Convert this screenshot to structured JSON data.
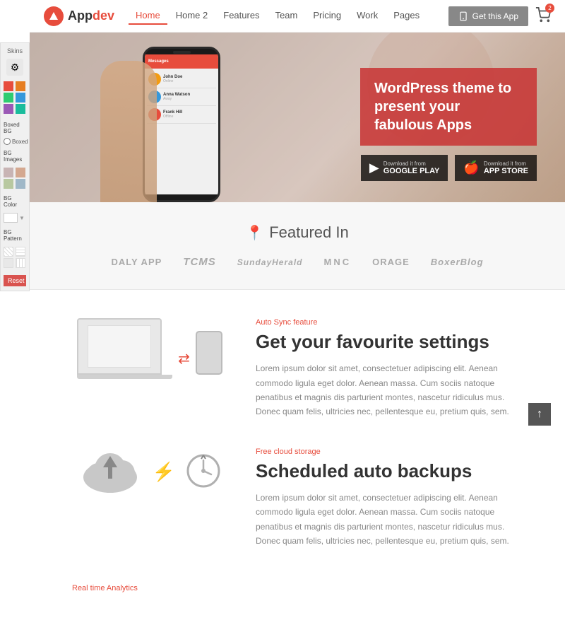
{
  "skins": {
    "label": "Skins",
    "colors": [
      "#e74c3c",
      "#e67e22",
      "#2ecc71",
      "#3498db",
      "#9b59b6",
      "#1abc9c",
      "#e74c3c",
      "#f39c12"
    ],
    "boxed_bg_label": "Boxed BG",
    "boxed_label": "Boxed",
    "bg_images_label": "BG Images",
    "bg_color_label": "BG Color",
    "bg_pattern_label": "BG Pattern",
    "reset_label": "Reset",
    "bg_images": [
      "#c8b4b4",
      "#d4a890",
      "#b8c8a0",
      "#a0b8c8"
    ]
  },
  "navbar": {
    "logo_text": "Appdev",
    "links": [
      "Home",
      "Home 2",
      "Features",
      "Team",
      "Pricing",
      "Work",
      "Pages"
    ],
    "active_link": "Home",
    "get_app_label": "Get this App",
    "cart_count": "2"
  },
  "hero": {
    "title": "WordPress theme to present your fabulous Apps",
    "google_play_small": "Download it from",
    "google_play_large": "GOOGLE PLAY",
    "app_store_small": "Download it from",
    "app_store_large": "APP STORE",
    "phone_app_bar": "Messages",
    "users": [
      {
        "name": "John Doe",
        "status": "Online"
      },
      {
        "name": "Anna Watson",
        "status": "Away"
      },
      {
        "name": "Frank Hill",
        "status": "Offline"
      }
    ]
  },
  "featured": {
    "title": "Featured In",
    "logos": [
      "DALY APP",
      "TCMS",
      "SundayHerald",
      "MNC",
      "ORAGE",
      "BoxerBlog"
    ]
  },
  "features": [
    {
      "tag": "Auto Sync feature",
      "title": "Get your favourite settings",
      "desc": "Lorem ipsum dolor sit amet, consectetuer adipiscing elit. Aenean commodo ligula eget dolor. Aenean massa. Cum sociis natoque penatibus et magnis dis parturient montes, nascetur ridiculus mus. Donec quam felis, ultricies nec, pellentesque eu, pretium quis, sem.",
      "type": "sync"
    },
    {
      "tag": "Free cloud storage",
      "title": "Scheduled auto backups",
      "desc": "Lorem ipsum dolor sit amet, consectetuer adipiscing elit. Aenean commodo ligula eget dolor. Aenean massa. Cum sociis natoque penatibus et magnis dis parturient montes, nascetur ridiculus mus. Donec quam felis, ultricies nec, pellentesque eu, pretium quis, sem.",
      "type": "cloud"
    },
    {
      "tag": "Real time Analytics",
      "title": "",
      "desc": "",
      "type": "analytics"
    }
  ],
  "scroll_top": "↑"
}
